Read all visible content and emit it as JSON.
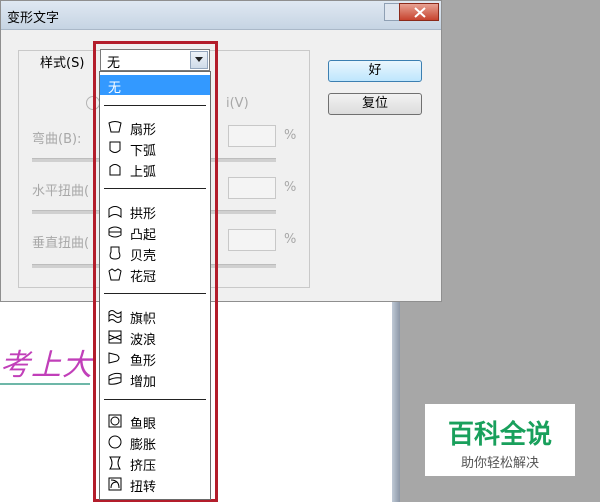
{
  "window": {
    "title": "变形文字"
  },
  "controls": {
    "style_label": "样式(S)",
    "style_value": "无",
    "ok_label": "好",
    "reset_label": "复位"
  },
  "fields": {
    "bend_label": "弯曲(B):",
    "hdistort_label": "水平扭曲(",
    "vdistort_label": "垂直扭曲(",
    "percent": "%",
    "radio_partial": "i(V)"
  },
  "dropdown": {
    "selected": "无",
    "groups": [
      [
        "扇形",
        "下弧",
        "上弧"
      ],
      [
        "拱形",
        "凸起",
        "贝壳",
        "花冠"
      ],
      [
        "旗帜",
        "波浪",
        "鱼形",
        "增加"
      ],
      [
        "鱼眼",
        "膨胀",
        "挤压",
        "扭转"
      ]
    ]
  },
  "canvas": {
    "text": "考上大"
  },
  "watermark": {
    "title": "百科全说",
    "subtitle": "助你轻松解决"
  },
  "colors": {
    "highlight": "#3399ff",
    "frame": "#b31d2b",
    "canvas_text": "#c13fb9",
    "watermark": "#19a05c"
  }
}
